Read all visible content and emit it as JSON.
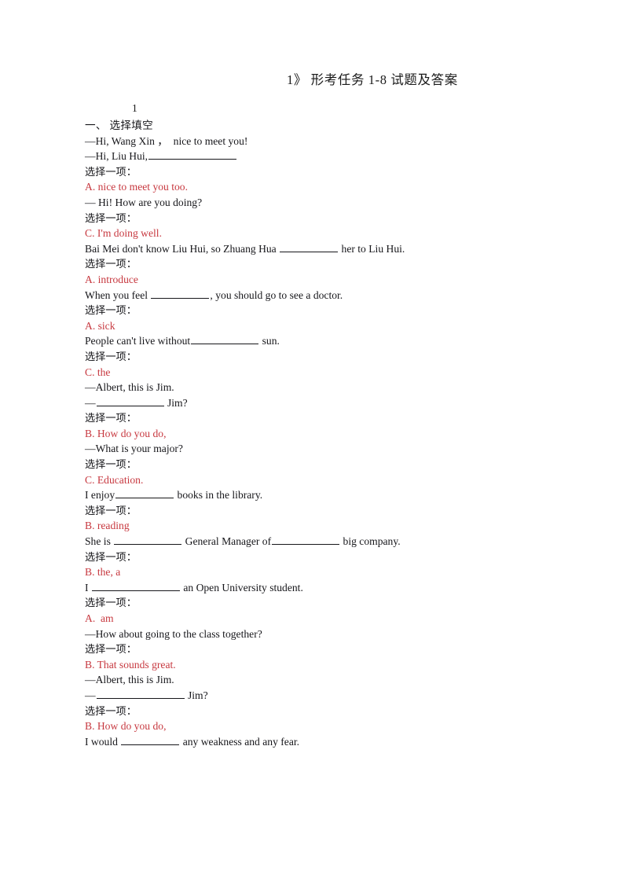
{
  "document": {
    "title": "1》 形考任务 1-8 试题及答案",
    "page_marker": "1",
    "section_heading": "一、 选择填空",
    "prompt_label": "选择一项：",
    "answer_color": "#c7383f",
    "text_color": "#16161a"
  },
  "items": [
    {
      "question_lines": [
        "—Hi, Wang Xin ，  nice to meet you!",
        "—Hi, Liu Hui,"
      ],
      "blank_after_line": 1,
      "blank_size": "w-xl",
      "prompt": "选择一项：",
      "answer": "A. nice to meet you too."
    },
    {
      "question_lines": [
        "— Hi! How are you doing?"
      ],
      "prompt": "选择一项：",
      "answer": "C. I'm doing well."
    },
    {
      "question_text_before": "Bai Mei don't know Liu Hui, so Zhuang Hua ",
      "blank_size": "w-md",
      "question_text_after": " her to Liu Hui.",
      "prompt": "选择一项：",
      "answer": "A. introduce"
    },
    {
      "question_text_before": "When you feel ",
      "blank_size": "w-md",
      "question_text_after": ", you should go to see a doctor.",
      "prompt": "选择一项：",
      "answer": "A. sick"
    },
    {
      "question_text_before": "People can't live without",
      "blank_size": "w-lg",
      "question_text_after": " sun.",
      "prompt": "选择一项：",
      "answer": "C. the"
    },
    {
      "question_lines": [
        "—Albert, this is Jim.",
        "—"
      ],
      "blank_after_line": 1,
      "blank_size": "w-lg",
      "trailing_text": " Jim?",
      "prompt": "选择一项：",
      "answer": "B. How do you do,"
    },
    {
      "question_lines": [
        "—What is your major?"
      ],
      "prompt": "选择一项：",
      "answer": "C. Education."
    },
    {
      "question_text_before": "I enjoy",
      "blank_size": "w-md",
      "question_text_after": " books in the library.",
      "prompt": "选择一项：",
      "answer": "B. reading"
    },
    {
      "question_text_before": "She is ",
      "blank_size": "w-lg",
      "question_text_middle": " General Manager of",
      "blank_size_2": "w-lg",
      "question_text_after": " big company.",
      "prompt": "选择一项：",
      "answer": "B. the, a"
    },
    {
      "question_text_before": "I ",
      "blank_size": "w-xl",
      "question_text_after": " an Open University student.",
      "prompt": "选择一项：",
      "answer": "A.  am"
    },
    {
      "question_lines": [
        "—How about going to the class together?"
      ],
      "prompt": "选择一项：",
      "answer": "B. That sounds great."
    },
    {
      "question_lines": [
        "—Albert, this is Jim.",
        "—"
      ],
      "blank_after_line": 1,
      "blank_size": "w-xl",
      "trailing_text": " Jim?",
      "prompt": "选择一项：",
      "answer": "B. How do you do,"
    },
    {
      "question_text_before": "I would ",
      "blank_size": "w-md",
      "question_text_after": " any weakness and any fear."
    }
  ]
}
